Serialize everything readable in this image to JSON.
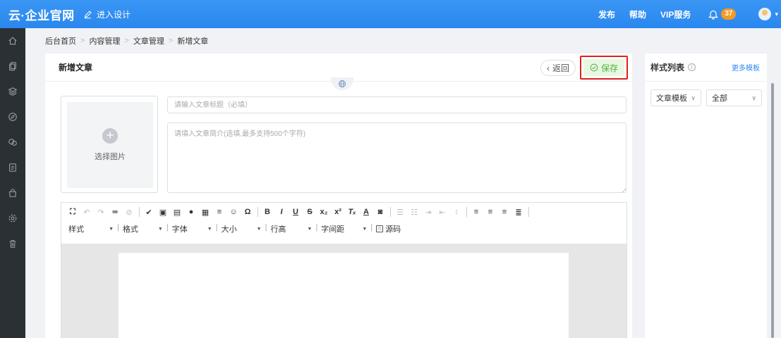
{
  "topbar": {
    "logo": "云·企业官网",
    "design_label": "进入设计",
    "publish": "发布",
    "help": "帮助",
    "vip": "VIP服务",
    "notification_count": "37",
    "brand_color": "#2d8cf0"
  },
  "sidebar": {
    "icons": [
      "home-icon",
      "copy-icon",
      "layers-icon",
      "compass-icon",
      "chat-icon",
      "document-icon",
      "shop-icon",
      "settings-icon",
      "trash-icon"
    ]
  },
  "breadcrumb": [
    "后台首页",
    "内容管理",
    "文章管理",
    "新增文章"
  ],
  "main": {
    "title": "新增文章",
    "back_label": "返回",
    "save_label": "保存",
    "image_label": "选择图片",
    "title_placeholder": "请输入文章标题（必填）",
    "summary_placeholder": "请填入文章简介(选填,最多支持500个字符)",
    "toolbar_dropdowns": [
      "样式",
      "格式",
      "字体",
      "大小",
      "行高",
      "字间距"
    ],
    "source_label": "源码"
  },
  "right": {
    "title": "样式列表",
    "more_label": "更多模板",
    "template_select": "文章模板",
    "filter_select": "全部"
  }
}
